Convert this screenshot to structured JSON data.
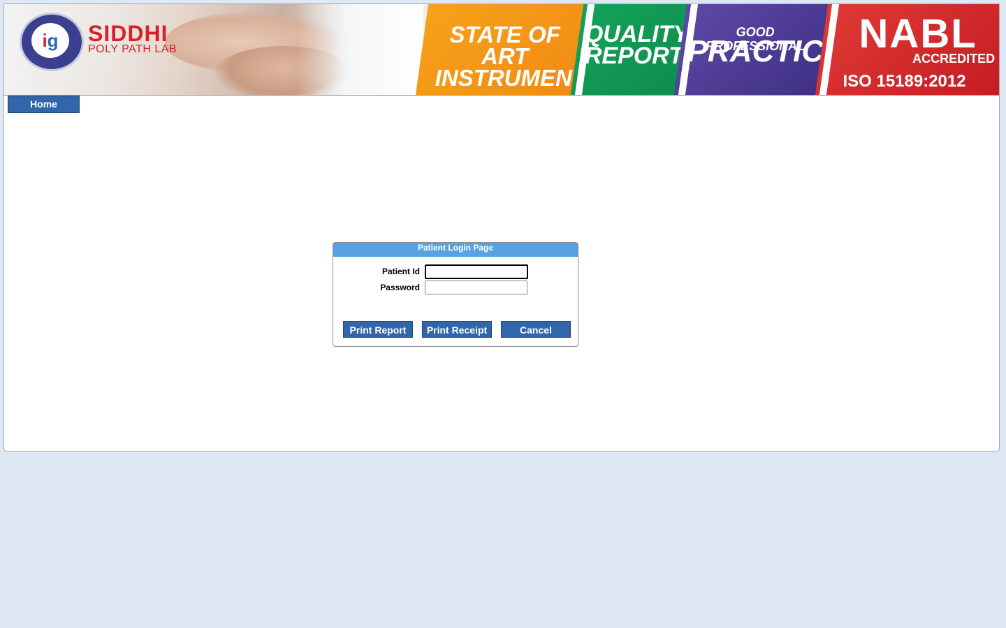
{
  "banner": {
    "brand_name": "SIDDHI",
    "brand_sub": "POLY PATH LAB",
    "logo_letters": [
      "i",
      "g"
    ],
    "panels": {
      "orange": "STATE OF ART INSTRUMENTS",
      "green": "QUALITY REPORT",
      "purple_small": "GOOD PROFESSIONAL",
      "purple_big": "PRACTICE",
      "nabl": "NABL",
      "accredited": "ACCREDITED",
      "iso": "ISO 15189:2012"
    },
    "colors": {
      "orange": "#f18a13",
      "green": "#0f8c4d",
      "purple": "#3f2f86",
      "red": "#c41c24",
      "brand_red": "#d62128",
      "logo_blue": "#3b3f8f"
    }
  },
  "nav": {
    "home_label": "Home"
  },
  "login": {
    "title": "Patient Login Page",
    "patient_id_label": "Patient Id",
    "patient_id_value": "",
    "password_label": "Password",
    "password_value": "",
    "buttons": {
      "print_report": "Print Report",
      "print_receipt": "Print Receipt",
      "cancel": "Cancel"
    }
  },
  "theme": {
    "accent": "#3166aa",
    "header_blue": "#56a2e2",
    "page_bg": "#dee8f4"
  }
}
